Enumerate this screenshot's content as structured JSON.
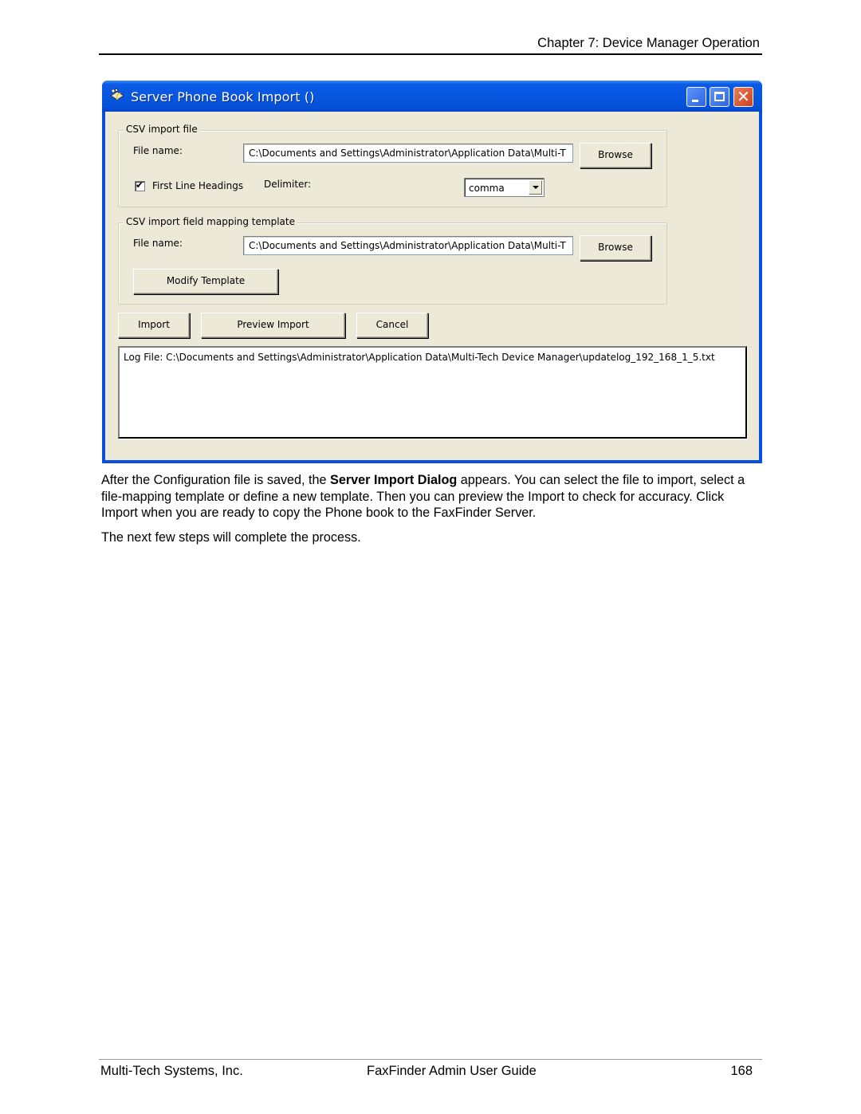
{
  "page": {
    "header": "Chapter 7: Device Manager Operation",
    "footer": {
      "company": "Multi-Tech Systems, Inc.",
      "guide": "FaxFinder Admin User Guide",
      "page_number": "168"
    }
  },
  "dialog": {
    "title": "Server Phone Book Import ()",
    "icons": {
      "app": "phone-book-app-icon",
      "minimize": "minimize-icon",
      "maximize": "maximize-icon",
      "close": "close-icon"
    },
    "csv_import_file": {
      "legend": "CSV import file",
      "file_name_label": "File name:",
      "file_name_value": "C:\\Documents and Settings\\Administrator\\Application Data\\Multi-T",
      "browse_label": "Browse",
      "first_line_headings_label": "First Line Headings",
      "first_line_headings_checked": true,
      "delimiter_label": "Delimiter:",
      "delimiter_value": "comma"
    },
    "mapping_template": {
      "legend": "CSV import field mapping template",
      "file_name_label": "File name:",
      "file_name_value": "C:\\Documents and Settings\\Administrator\\Application Data\\Multi-T",
      "browse_label": "Browse",
      "modify_template_label": "Modify Template"
    },
    "buttons": {
      "import": "Import",
      "preview_import": "Preview Import",
      "cancel": "Cancel"
    },
    "log_text": "Log File: C:\\Documents and Settings\\Administrator\\Application Data\\Multi-Tech Device Manager\\updatelog_192_168_1_5.txt"
  },
  "body": {
    "para1_before": "After the Configuration file is saved, the ",
    "para1_bold": "Server Import Dialog",
    "para1_after": " appears. You can select the file to import, select a file-mapping template or define a new template. Then you can preview the Import to check for accuracy. Click Import when you are ready to copy the Phone book to the FaxFinder Server.",
    "para2": "The next few steps will complete the process."
  }
}
